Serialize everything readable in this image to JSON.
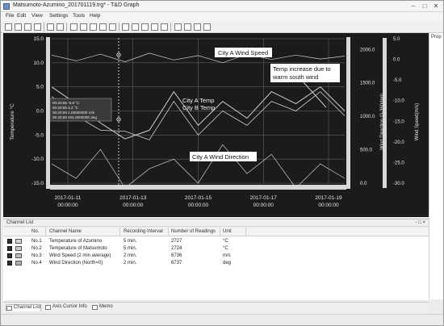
{
  "window": {
    "title": "Matsumoto-Azumino_201701119.trg* - T&D Graph"
  },
  "menu": {
    "items": [
      "File",
      "Edit",
      "View",
      "Settings",
      "Tools",
      "Help"
    ]
  },
  "right_panel": {
    "label": "Prop"
  },
  "chart": {
    "annotations": {
      "wind_speed": "City A Wind Speed",
      "temp": "City A Temp",
      "temp_b": "City B Temp",
      "wind_dir": "City A Wind Direction",
      "note_line1": "Temp increase due to",
      "note_line2": "warm south wind"
    },
    "cursor_readout": [
      "00:20:55  -5.8  °C",
      "00:20:55  4.2  °C",
      "00:20:56  1.02000000 m/s",
      "00:20:58  201.0000000 deg"
    ]
  },
  "chart_data": {
    "type": "line",
    "xlabel": "",
    "x": [
      "2017-01-11 00:00:00",
      "2017-01-13 00:00:00",
      "2017-01-15 00:00:00",
      "2017-01-17 00:00:00",
      "2017-01-19 00:00:00"
    ],
    "y_axes": [
      {
        "label": "Temperature °C",
        "ticks": [
          "15.0",
          "10.0",
          "5.0",
          "0.0",
          "-5.0",
          "-10.0",
          "-15.0"
        ],
        "range": [
          -15,
          15
        ]
      },
      {
        "label": "Wind Direction (0-360deg)",
        "ticks": [
          "2000.0",
          "1500.0",
          "1000.0",
          "500.0",
          "0.0"
        ],
        "range": [
          0,
          2160
        ]
      },
      {
        "label": "Wind Speed(m/s)",
        "ticks": [
          "5.0",
          "0.0",
          "-5.0",
          "-10.0",
          "-15.0",
          "-20.0",
          "-25.0",
          "-30.0"
        ],
        "range": [
          -30,
          5
        ]
      }
    ],
    "series": [
      {
        "name": "City A Temp",
        "values": [
          5,
          1.5,
          -2.5,
          -5.8,
          -4,
          4,
          -3,
          2,
          -1.5,
          4,
          1.5,
          5,
          0
        ]
      },
      {
        "name": "City B Temp",
        "values": [
          3,
          -1,
          -4,
          -4.2,
          -6,
          2,
          -5,
          0,
          -3,
          2,
          0,
          4,
          -1
        ]
      },
      {
        "name": "City A Wind Speed",
        "values": [
          2.6,
          1.4,
          2.8,
          1.2,
          3.0,
          1.6,
          2.5,
          1.0,
          2.8,
          1.7,
          2.6,
          1.8,
          2.4
        ]
      },
      {
        "name": "City A Wind Direction",
        "values": [
          25,
          28,
          22,
          30,
          26,
          24,
          29,
          21,
          27,
          23,
          30,
          25,
          28
        ]
      }
    ],
    "colors": {
      "background": "#1b1b1b",
      "lines": "#cfcfcf",
      "grid": "#8a8a8a"
    }
  },
  "channel_list": {
    "panel_title": "Channel List",
    "panel_buttons": "- □ ×",
    "headers": [
      "No.",
      "Channel Name",
      "Recording Interval",
      "Number of Readings",
      "Unit"
    ],
    "rows": [
      {
        "no": "No.1",
        "name": "Temperature of Azumino",
        "interval": "5 min.",
        "readings": "2727",
        "unit": "°C",
        "color": "#d6d6d6"
      },
      {
        "no": "No.2",
        "name": "Temperature of Matsumoto",
        "interval": "5 min.",
        "readings": "2724",
        "unit": "°C",
        "color": "#c9c9c9"
      },
      {
        "no": "No.3",
        "name": "Wind Speed (2 min average)",
        "interval": "2 min.",
        "readings": "6736",
        "unit": "m/s",
        "color": "#bdbdbd"
      },
      {
        "no": "No.4",
        "name": "Wind Direction (North=0)",
        "interval": "2 min.",
        "readings": "6737",
        "unit": "deg",
        "color": "#b0b0b0"
      }
    ]
  },
  "bottom_tabs": [
    "Channel List",
    "Axis Cursor Info",
    "Memo"
  ]
}
